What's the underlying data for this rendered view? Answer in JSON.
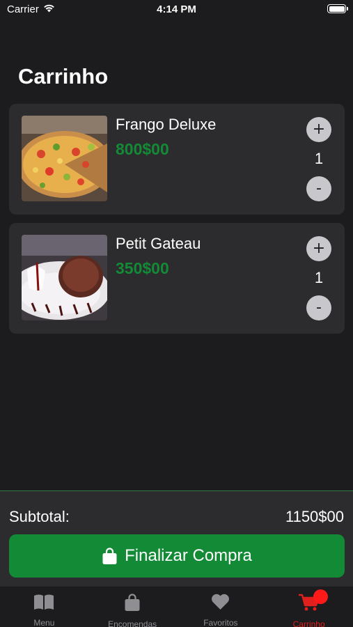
{
  "status_bar": {
    "carrier": "Carrier",
    "time": "4:14 PM"
  },
  "title": "Carrinho",
  "cart_items": [
    {
      "name": "Frango Deluxe",
      "price": "800$00",
      "quantity": "1",
      "image": "pizza-photo"
    },
    {
      "name": "Petit Gateau",
      "price": "350$00",
      "quantity": "1",
      "image": "petit-gateau-photo"
    }
  ],
  "controls": {
    "plus": "+",
    "minus": "-"
  },
  "summary": {
    "subtotal_label": "Subtotal:",
    "subtotal_value": "1150$00"
  },
  "checkout": {
    "label": "Finalizar Compra",
    "icon": "shopping-bag-icon"
  },
  "tabs": [
    {
      "label": "Menu",
      "icon": "book-icon",
      "active": false
    },
    {
      "label": "Encomendas",
      "icon": "bag-icon",
      "active": false
    },
    {
      "label": "Favoritos",
      "icon": "heart-icon",
      "active": false
    },
    {
      "label": "Carrinho",
      "icon": "cart-icon",
      "active": true
    }
  ],
  "colors": {
    "accent_green": "#138a36",
    "active_tab": "#e0201c",
    "background": "#1c1c1e",
    "card": "#2c2c2e"
  }
}
